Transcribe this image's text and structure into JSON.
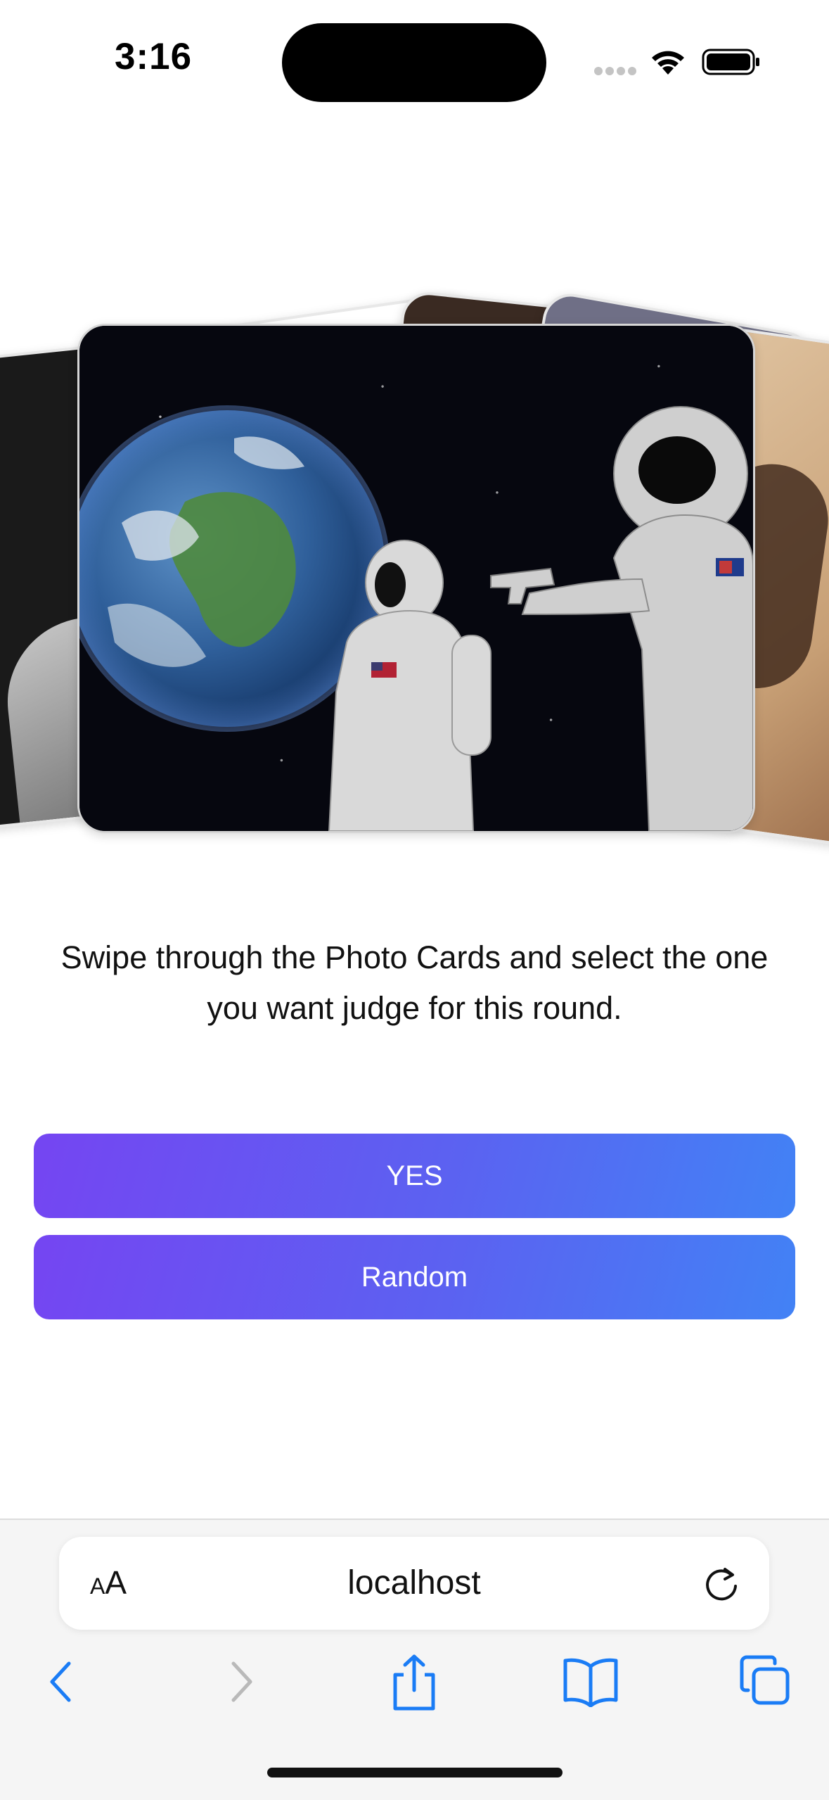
{
  "status_bar": {
    "time": "3:16"
  },
  "cards": {
    "main_card_image": "astronaut-meme-image",
    "card_count_visible": 6
  },
  "instructions": "Swipe through the Photo Cards and select the one you want judge for this round.",
  "buttons": {
    "yes_label": "YES",
    "random_label": "Random"
  },
  "safari": {
    "aa_label_small": "A",
    "aa_label_large": "A",
    "url": "localhost"
  },
  "colors": {
    "button_gradient_start": "#7545f2",
    "button_gradient_end": "#4282f5",
    "safari_accent": "#1a7cf5"
  }
}
